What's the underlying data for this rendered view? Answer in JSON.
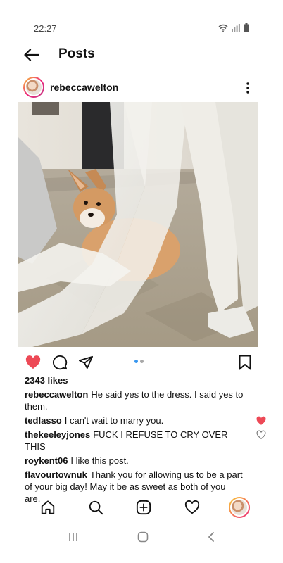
{
  "status_bar": {
    "time": "22:27",
    "icons": [
      "wifi-icon",
      "signal-icon",
      "battery-icon"
    ]
  },
  "header": {
    "title": "Posts",
    "back_icon": "arrow-left-icon"
  },
  "post": {
    "username": "rebeccawelton",
    "more_icon": "more-vertical-icon",
    "image_description_icon": "photo",
    "liked": true,
    "like_color": "#ed4956",
    "likes_text": "2343 likes",
    "carousel_active_color": "#3897f0",
    "carousel_inactive_color": "#a8a8a8",
    "comments": [
      {
        "user": "rebeccawelton",
        "text": "He said yes to the dress. I said yes to them.",
        "liked": null
      },
      {
        "user": "tedlasso",
        "text": "I can't wait to marry you.",
        "liked": true
      },
      {
        "user": "thekeeleyjones",
        "text": "FUCK I REFUSE TO CRY OVER THIS",
        "liked": false
      },
      {
        "user": "roykent06",
        "text": "I like this post.",
        "liked": null
      },
      {
        "user": "flavourtownuk",
        "text": "Thank you for allowing us to be a part of your big day! May it be as sweet as both of you are.",
        "liked": null
      }
    ]
  },
  "bottom_nav": {
    "items": [
      "home-icon",
      "search-icon",
      "add-post-icon",
      "activity-heart-icon",
      "profile-avatar"
    ]
  },
  "system_nav": {
    "items": [
      "recents-icon",
      "home-circle-icon",
      "back-chevron-icon"
    ]
  }
}
